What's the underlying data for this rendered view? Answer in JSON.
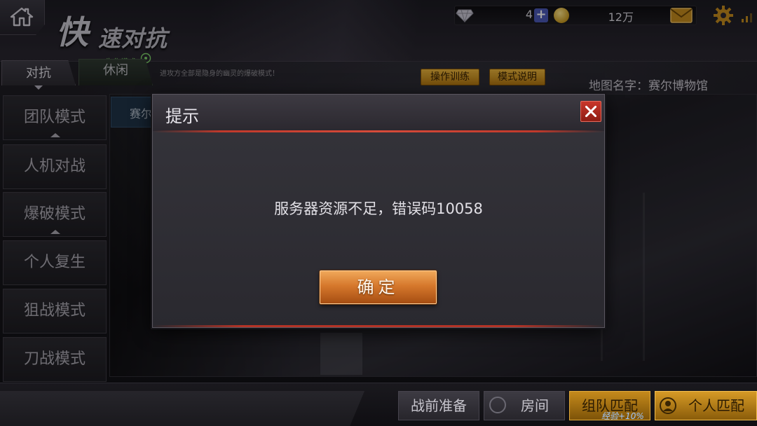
{
  "header": {
    "title_first": "快",
    "title_rest": "速对抗",
    "mode_tag": "生化模式",
    "mode_description": "进攻方全部是隐身的幽灵的爆破模式！",
    "currency": {
      "diamonds": "4",
      "diamond_add": "+",
      "coins": "12万"
    }
  },
  "tabs": [
    {
      "label": "对抗",
      "selected": true
    },
    {
      "label": "休闲",
      "selected": false
    }
  ],
  "actions": {
    "training": "操作训练",
    "mode_info": "模式说明"
  },
  "map": {
    "name": "地图名字：赛尔博物馆",
    "tab_label": "赛尔"
  },
  "sidebar": {
    "items": [
      {
        "label": "团队模式",
        "caret": true
      },
      {
        "label": "人机对战",
        "caret": false
      },
      {
        "label": "爆破模式",
        "caret": true
      },
      {
        "label": "个人复生",
        "caret": false
      },
      {
        "label": "狙战模式",
        "caret": false
      },
      {
        "label": "刀战模式",
        "caret": false
      }
    ]
  },
  "dialog": {
    "title": "提示",
    "message": "服务器资源不足，错误码10058",
    "confirm": "确定"
  },
  "bottom": {
    "prep": "战前准备",
    "room": "房间",
    "team_match": "组队匹配",
    "team_bonus": "经验+10%",
    "solo_match": "个人匹配"
  },
  "colors": {
    "accent_red": "#c0392b",
    "confirm_orange": "#d6782c",
    "gold": "#e9b43c",
    "bio_green": "#7fd36a"
  },
  "icons": [
    "home-icon",
    "diamond-icon",
    "coin-icon",
    "mail-icon",
    "gear-icon",
    "signal-icon",
    "biohazard-icon",
    "close-icon",
    "room-icon",
    "solo-icon"
  ]
}
